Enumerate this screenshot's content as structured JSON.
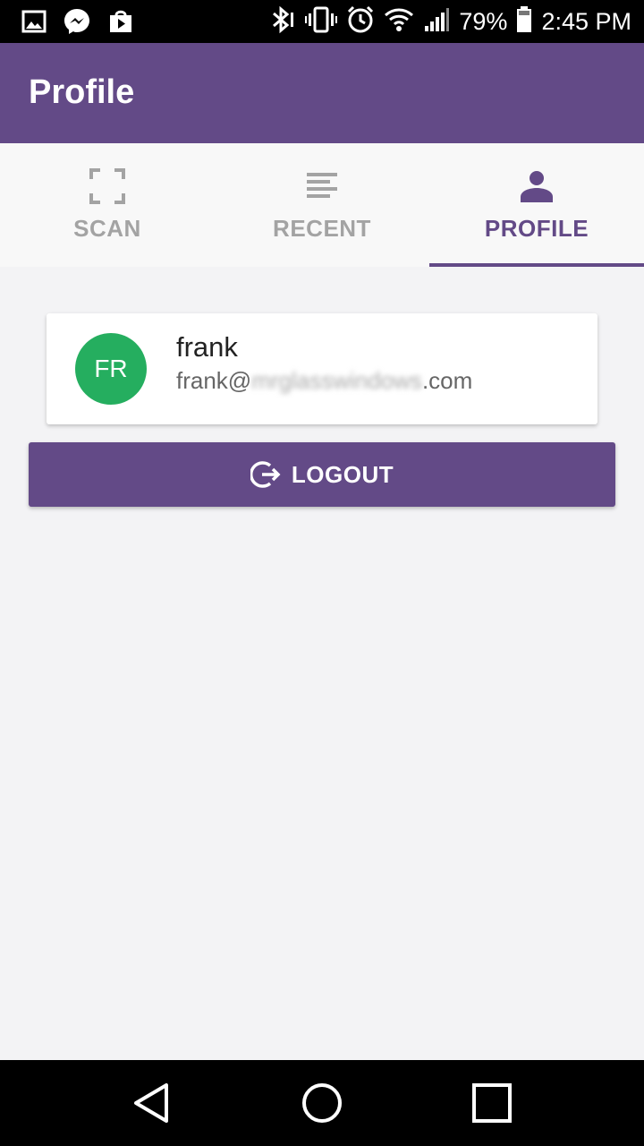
{
  "status_bar": {
    "battery": "79%",
    "time": "2:45 PM",
    "left_icons": [
      "gallery-icon",
      "messenger-icon",
      "play-store-icon"
    ],
    "right_icons": [
      "bluetooth-icon",
      "vibrate-icon",
      "alarm-icon",
      "wifi-icon",
      "signal-icon",
      "battery-icon"
    ]
  },
  "app_bar": {
    "title": "Profile"
  },
  "tabs": [
    {
      "label": "SCAN",
      "icon": "scan-icon",
      "active": false
    },
    {
      "label": "RECENT",
      "icon": "list-icon",
      "active": false
    },
    {
      "label": "PROFILE",
      "icon": "person-icon",
      "active": true
    }
  ],
  "profile": {
    "initials": "FR",
    "name": "frank",
    "email_prefix": "frank@",
    "email_domain_hidden": "mrglasswindows",
    "email_suffix": ".com"
  },
  "logout": {
    "label": "LOGOUT",
    "icon": "logout-icon"
  },
  "nav": [
    "back-icon",
    "home-icon",
    "recents-icon"
  ],
  "colors": {
    "primary": "#634a87",
    "avatar": "#25ae5f",
    "background": "#f3f3f5",
    "inactive_tab": "#a3a3a3"
  }
}
